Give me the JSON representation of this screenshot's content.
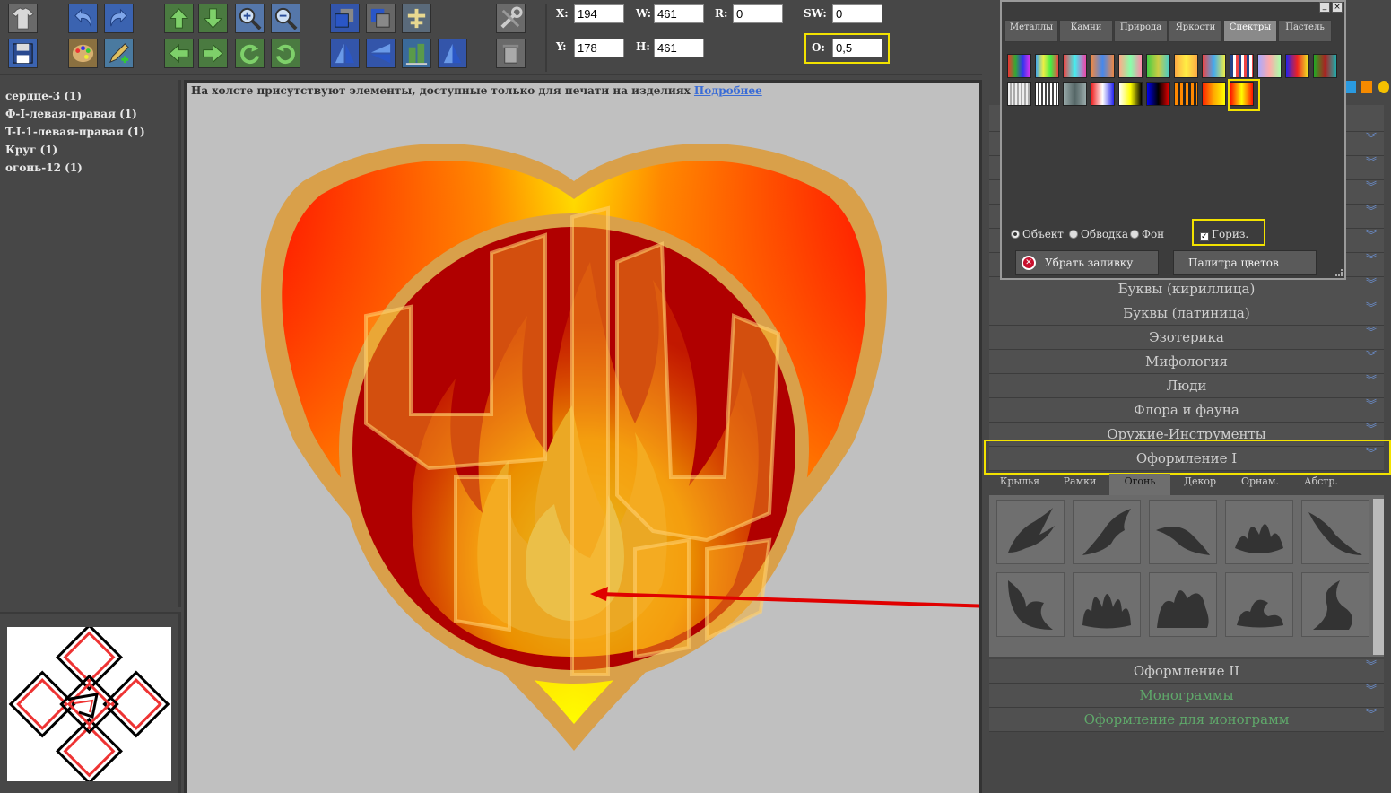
{
  "toolbar": {
    "icons_row1": [
      "tshirt-icon",
      "undo-icon",
      "redo-icon",
      "move-up-icon",
      "move-down-icon",
      "zoom-in-icon",
      "zoom-out-icon",
      "bring-front-icon",
      "send-back-icon",
      "group-icon",
      "tools-icon"
    ],
    "icons_row2": [
      "save-icon",
      "palette-icon",
      "edit-icon",
      "move-left-icon",
      "move-right-icon",
      "rotate-ccw-icon",
      "rotate-cw-icon",
      "flip-vertical-icon",
      "flip-horizontal-icon",
      "align-icon",
      "align-center-icon",
      "trash-icon"
    ],
    "fields": {
      "x_label": "X:",
      "x_value": "194",
      "w_label": "W:",
      "w_value": "461",
      "r_label": "R:",
      "r_value": "0",
      "sw_label": "SW:",
      "sw_value": "0",
      "y_label": "Y:",
      "y_value": "178",
      "h_label": "H:",
      "h_value": "461",
      "o_label": "O:",
      "o_value": "0,5"
    }
  },
  "layers": [
    "сердце-3 (1)",
    "Ф-I-левая-правая (1)",
    "T-I-1-левая-правая (1)",
    "Круг (1)",
    "огонь-12 (1)"
  ],
  "canvas": {
    "notice_text": "На холсте присутствуют элементы, доступные только для печати на изделиях ",
    "notice_link": "Подробнее"
  },
  "palette": {
    "tabs": [
      "Металлы",
      "Камни",
      "Природа",
      "Яркости",
      "Спектры",
      "Пастель"
    ],
    "active_tab": "Спектры",
    "radio_object": "Объект",
    "radio_stroke": "Обводка",
    "radio_bg": "Фон",
    "checkbox_horiz": "Гориз.",
    "remove_fill_button": "Убрать заливку",
    "color_palette_button": "Палитра цветов"
  },
  "categories": [
    "Буквы (кириллица)",
    "Буквы (латиница)",
    "Эзотерика",
    "Мифология",
    "Люди",
    "Флора и фауна",
    "Оружие-Инструменты",
    "Оформление I"
  ],
  "subtabs": [
    "Крылья",
    "Рамки",
    "Огонь",
    "Декор",
    "Орнам.",
    "Абстр."
  ],
  "active_subtab": "Огонь",
  "bottom_categories": [
    "Оформление II",
    "Монограммы",
    "Оформление для монограмм"
  ],
  "colors": {
    "highlight": "#f2e200",
    "arrow": "#e00000",
    "heart_outline": "#d9a04a",
    "heart_fill_red": "#ff2a00",
    "heart_fill_yellow": "#ffe000",
    "circle_fill": "#b00000",
    "link": "#3a6cd6"
  }
}
